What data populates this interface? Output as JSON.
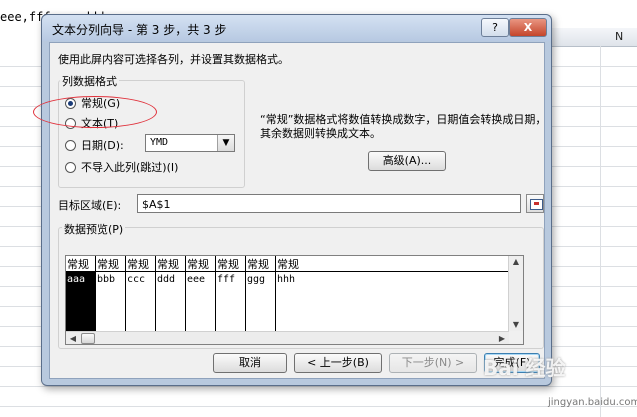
{
  "sheet": {
    "cell_text": "eee,fff,ggg,hhh",
    "column_label": "N"
  },
  "dialog": {
    "title": "文本分列向导 - 第 3 步，共 3 步",
    "help_label": "?",
    "close_label": "X",
    "instruction": "使用此屏内容可选择各列，并设置其数据格式。",
    "column_format": {
      "title": "列数据格式",
      "options": [
        {
          "label": "常规(G)",
          "checked": true
        },
        {
          "label": "文本(T)",
          "checked": false
        },
        {
          "label": "日期(D):",
          "checked": false
        },
        {
          "label": "不导入此列(跳过)(I)",
          "checked": false
        }
      ],
      "date_format": "YMD"
    },
    "description": "“常规”数据格式将数值转换成数字，日期值会转换成日期，其余数据则转换成文本。",
    "advanced_label": "高级(A)...",
    "target": {
      "label": "目标区域(E):",
      "value": "$A$1"
    },
    "preview": {
      "title": "数据预览(P)",
      "headers": [
        "常规",
        "常规",
        "常规",
        "常规",
        "常规",
        "常规",
        "常规",
        "常规"
      ],
      "cells": [
        "aaa",
        "bbb",
        "ccc",
        "ddd",
        "eee",
        "fff",
        "ggg",
        "hhh"
      ],
      "selected_index": 0
    },
    "buttons": {
      "cancel": "取消",
      "back": "< 上一步(B)",
      "next": "下一步(N) >",
      "finish": "完成(F)"
    }
  },
  "watermark": {
    "brand": "Bai 经验",
    "url": "jingyan.baidu.com"
  },
  "colors": {
    "highlight_ellipse": "#e0323c",
    "title_bar": "#b7c9e2"
  }
}
